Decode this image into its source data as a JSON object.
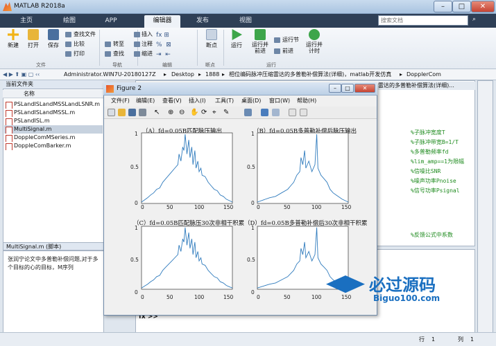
{
  "app": {
    "title": "MATLAB R2018a",
    "win_min": "–",
    "win_max": "□",
    "win_close": "✕"
  },
  "tabs": [
    "主页",
    "绘图",
    "APP",
    "编辑器",
    "发布",
    "视图"
  ],
  "search_placeholder": "搜索文档",
  "ribbon": {
    "file_buttons": [
      "新建",
      "打开",
      "保存"
    ],
    "file_small": [
      "查找文件",
      "比较",
      "打印"
    ],
    "nav_small": [
      "转至",
      "查找"
    ],
    "edit_small": [
      "插入",
      "注释",
      "缩进"
    ],
    "breakpoint": "断点",
    "run_buttons": [
      "运行",
      "运行并\n前进",
      "运行节",
      "前进",
      "运行并\n计时"
    ],
    "groups": [
      "文件",
      "导航",
      "编辑",
      "断点",
      "运行"
    ]
  },
  "address": {
    "path": [
      "Administrator.WIN7U-20180127Z",
      "Desktop",
      "1888",
      "相位编码脉冲压缩雷达的多普勒补偿算法(详细)，matlab开发仿真",
      "DopplerCom"
    ]
  },
  "current_folder": {
    "title": "当前文件夹",
    "column": "名称",
    "files": [
      "PSLandISLandMSSLandLSNR.m",
      "PSLandISLandMSSL.m",
      "PSLandISL.m",
      "MultiSignal.m",
      "DoppleComMSeries.m",
      "DoppleComBarker.m"
    ],
    "selected": 3
  },
  "details": {
    "title": "MultiSignal.m  (脚本)",
    "text": "张润宁论文中多普勒补偿问题,对于多个目标的心的目标，M序列"
  },
  "editor": {
    "tab": "雷达的多普勒补偿算法(详细)...",
    "comments": [
      "%子脉冲宽度T",
      "%子脉冲带宽B=1/T",
      "%多普勒频率fd",
      "%lim_amp==1为限幅",
      "%信噪比SNR",
      "%噪声功率Pnoise",
      "%信号功率Psignal",
      "%反馈公式中系数"
    ]
  },
  "cmd": {
    "prompt": "fx >>"
  },
  "status": {
    "row_label": "行",
    "row": "1",
    "col_label": "列",
    "col": "1"
  },
  "figure": {
    "title": "Figure 2",
    "menus": [
      "文件(F)",
      "编辑(E)",
      "查看(V)",
      "插入(I)",
      "工具(T)",
      "桌面(D)",
      "窗口(W)",
      "帮助(H)"
    ]
  },
  "chart_data": [
    {
      "type": "line",
      "title": "（A）fd=0.05B匹配脉压输出",
      "xlim": [
        0,
        150
      ],
      "ylim": [
        0,
        1
      ],
      "xticks": [
        "0",
        "50",
        "100",
        "150"
      ],
      "yticks": [
        "0",
        "0.5",
        "1"
      ],
      "x": [
        0,
        5,
        10,
        15,
        20,
        25,
        30,
        35,
        40,
        45,
        50,
        55,
        60,
        62,
        65,
        68,
        70,
        72,
        75,
        78,
        80,
        83,
        85,
        88,
        90,
        93,
        95,
        98,
        100,
        105,
        110,
        115,
        120,
        125,
        130,
        135,
        140,
        145,
        150
      ],
      "y": [
        0.02,
        0.05,
        0.08,
        0.12,
        0.15,
        0.2,
        0.22,
        0.3,
        0.35,
        0.4,
        0.45,
        0.5,
        0.55,
        0.7,
        0.6,
        0.8,
        0.75,
        0.98,
        0.7,
        0.9,
        0.65,
        0.8,
        0.55,
        0.75,
        0.5,
        0.6,
        0.45,
        0.5,
        0.4,
        0.38,
        0.3,
        0.25,
        0.2,
        0.18,
        0.12,
        0.1,
        0.06,
        0.04,
        0.02
      ]
    },
    {
      "type": "line",
      "title": "（B）fd=0.05B多普勒补偿后脉压输出",
      "xlim": [
        0,
        150
      ],
      "ylim": [
        0,
        1
      ],
      "xticks": [
        "0",
        "50",
        "100",
        "150"
      ],
      "yticks": [
        "0",
        "0.5",
        "1"
      ],
      "x": [
        0,
        10,
        20,
        30,
        40,
        50,
        55,
        60,
        65,
        70,
        72,
        75,
        78,
        80,
        85,
        90,
        95,
        98,
        100,
        105,
        110,
        115,
        120,
        125,
        130,
        140,
        150
      ],
      "y": [
        0.02,
        0.05,
        0.08,
        0.1,
        0.15,
        0.2,
        0.25,
        0.3,
        0.4,
        0.45,
        0.65,
        0.55,
        0.75,
        0.5,
        0.6,
        0.45,
        0.55,
        0.98,
        0.5,
        0.4,
        0.35,
        0.3,
        0.2,
        0.15,
        0.12,
        0.06,
        0.02
      ]
    },
    {
      "type": "line",
      "title": "（C）fd=0.05B匹配脉压30次非相干积累",
      "xlim": [
        0,
        150
      ],
      "ylim": [
        0,
        1
      ],
      "xticks": [
        "0",
        "50",
        "100",
        "150"
      ],
      "yticks": [
        "0",
        "0.5",
        "1"
      ],
      "x": [
        0,
        5,
        10,
        15,
        20,
        25,
        30,
        35,
        40,
        45,
        50,
        55,
        60,
        62,
        65,
        68,
        70,
        72,
        75,
        78,
        80,
        83,
        85,
        88,
        90,
        93,
        95,
        98,
        100,
        105,
        110,
        115,
        120,
        125,
        130,
        135,
        140,
        145,
        150
      ],
      "y": [
        0.02,
        0.05,
        0.08,
        0.12,
        0.15,
        0.2,
        0.22,
        0.3,
        0.35,
        0.4,
        0.45,
        0.5,
        0.55,
        0.7,
        0.6,
        0.8,
        0.75,
        0.98,
        0.7,
        0.9,
        0.65,
        0.8,
        0.55,
        0.75,
        0.5,
        0.6,
        0.45,
        0.5,
        0.4,
        0.38,
        0.3,
        0.25,
        0.2,
        0.18,
        0.12,
        0.1,
        0.06,
        0.04,
        0.02
      ]
    },
    {
      "type": "line",
      "title": "（D）fd=0.05B多普勒补偿后30次非相干积累",
      "xlim": [
        0,
        150
      ],
      "ylim": [
        0,
        1
      ],
      "xticks": [
        "0",
        "50",
        "100",
        "150"
      ],
      "yticks": [
        "0",
        "0.5",
        "1"
      ],
      "x": [
        0,
        10,
        20,
        30,
        40,
        50,
        55,
        60,
        65,
        70,
        72,
        75,
        78,
        80,
        85,
        90,
        95,
        98,
        100,
        105,
        110,
        115,
        120,
        125,
        130,
        140,
        150
      ],
      "y": [
        0.02,
        0.05,
        0.08,
        0.1,
        0.15,
        0.2,
        0.25,
        0.3,
        0.4,
        0.45,
        0.65,
        0.55,
        0.75,
        0.5,
        0.6,
        0.45,
        0.55,
        0.98,
        0.5,
        0.4,
        0.35,
        0.3,
        0.2,
        0.15,
        0.12,
        0.06,
        0.02
      ]
    }
  ],
  "watermark": {
    "title": "必过源码",
    "url": "Biguo100.com"
  },
  "colors": {
    "line": "#2f7bbd",
    "tab_bar": "#2e3f56",
    "accent": "#e8542a"
  }
}
